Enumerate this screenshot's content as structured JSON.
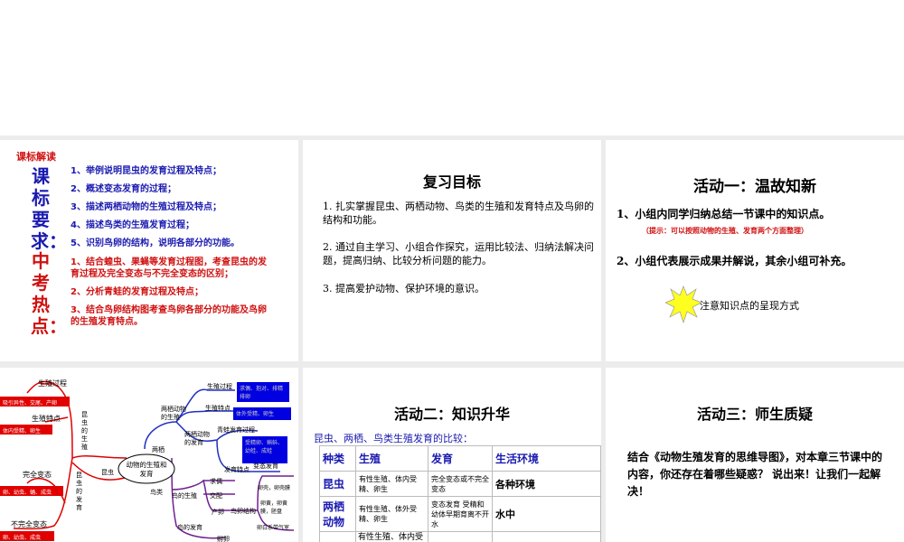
{
  "slides": [
    {
      "heading": "课标解读",
      "req_label": "课标要求：",
      "hot_label": "中考热点：",
      "requirements": [
        "1、举例说明昆虫的发育过程及特点；",
        "2、概述变态发育的过程；",
        "3、描述两栖动物的生殖过程及特点；",
        "4、描述鸟类的生殖发育过程；",
        "5、识别鸟卵的结构，说明各部分的功能。"
      ],
      "hotspots": [
        "1、结合蝗虫、果蝇等发育过程图，考查昆虫的发育过程及完全变态与不完全变态的区别；",
        "2、分析青蛙的发育过程及特点；",
        "3、结合鸟卵结构图考查鸟卵各部分的功能及鸟卵的生殖发育特点。"
      ]
    },
    {
      "title": "复习目标",
      "items": [
        "1. 扎实掌握昆虫、两栖动物、鸟类的生殖和发育特点及鸟卵的结构和功能。",
        "2. 通过自主学习、小组合作探究，运用比较法、归纳法解决问题，提高归纳、比较分析问题的能力。",
        "3. 提高爱护动物、保护环境的意识。"
      ]
    },
    {
      "title": "活动一：温故知新",
      "item1": "1、小组内同学归纳总结一节课中的知识点。",
      "hint": "（提示：可以按照动物的生殖、发育两个方面整理）",
      "item2": "2、小组代表展示成果并解说，其余小组可补充。",
      "note": "注意知识点的呈现方式"
    },
    {
      "center": "动物的生殖和发育",
      "insect": "昆虫",
      "amph": "两栖",
      "bird": "鸟类",
      "insect_repro": "昆虫的生殖",
      "insect_dev": "昆虫的发育",
      "repro_process": "生殖过程",
      "repro_process_box": "吸引异性、交尾、产卵",
      "repro_feature": "生殖特点",
      "repro_feature_box": "体内受精、卵生",
      "complete": "完全变态",
      "complete_box": "卵、幼虫、蛹、成虫",
      "incomplete": "不完全变态",
      "incomplete_box": "卵、幼虫、成虫",
      "amph_repro": "两栖动物的生殖",
      "amph_process": "生殖过程",
      "amph_process_box": "求偶、抱对、排精排卵",
      "amph_feature": "生殖特点",
      "amph_feature_box": "体外受精、卵生",
      "amph_dev": "两栖动物的发育",
      "frog_dev": "青蛙发育过程",
      "frog_dev_box": "受精卵、蝌蚪、幼蛙、成蛙",
      "dev_feature": "发育特点",
      "dev_feature_val": "变态发育",
      "bird_repro": "鸟的生殖",
      "court": "求偶",
      "mate": "交配",
      "lay": "产卵",
      "egg_struct": "鸟卵结构",
      "shell": "卵壳，卵壳膜",
      "yolk": "卵黄，卵黄膜，胚盘",
      "albumen": "卵白系带气室",
      "bird_dev": "鸟的发育",
      "hatch": "孵卵"
    },
    {
      "title": "活动二：知识升华",
      "subtitle": "昆虫、两栖、鸟类生殖发育的比较：",
      "headers": [
        "种类",
        "生殖",
        "发育",
        "生活环境"
      ],
      "rows": [
        [
          "昆虫",
          "有性生殖、体内受精、卵生",
          "完全变态或不完全变态",
          "各种环境"
        ],
        [
          "两栖动物",
          "有性生殖、体外受精、卵生",
          "变态发育 受精和幼体早期育离不开水",
          "水中"
        ],
        [
          "",
          "有性生殖、体内受",
          "",
          ""
        ]
      ]
    },
    {
      "title": "活动三：师生质疑",
      "body": "结合《动物生殖发育的思维导图》，对本章三节课中的内容，你还存在着哪些疑惑？ 说出来！让我们一起解决！"
    }
  ]
}
